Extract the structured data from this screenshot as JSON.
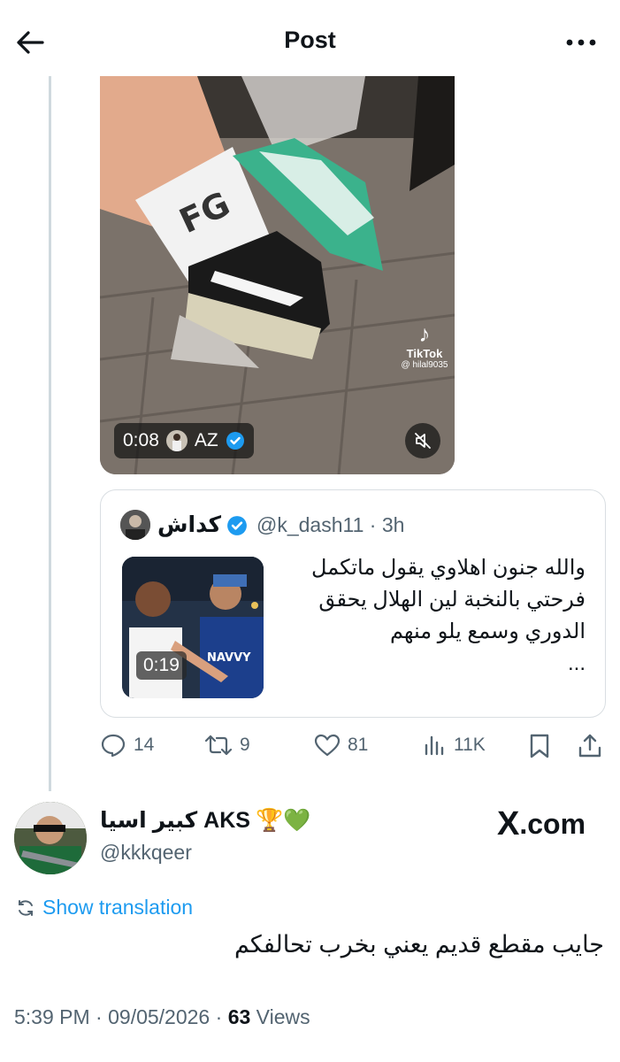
{
  "header": {
    "title": "Post"
  },
  "video": {
    "duration": "0:08",
    "author_name": "AZ",
    "watermark_brand": "TikTok",
    "watermark_handle": "@ hilal9035",
    "sock_text": "FG"
  },
  "quote": {
    "name": "كداش",
    "handle": "@k_dash11",
    "time": "3h",
    "text_line1": "والله جنون اهلاوي يقول ماتكمل",
    "text_line2": "فرحتي بالنخبة لين الهلال يحقق",
    "text_line3": "الدوري وسمع يلو منهم",
    "text_more": "...",
    "video_duration": "0:19",
    "thumb_shirt_text": "NAVVY"
  },
  "actions": {
    "replies": "14",
    "reposts": "9",
    "likes": "81",
    "views": "11K"
  },
  "reply": {
    "name": "كبير اسيا AKS",
    "emoji": "🏆💚",
    "handle": "@kkkqeer",
    "show_translation": "Show translation",
    "text": "جايب مقطع قديم يعني بخرب تحالفكم",
    "time": "5:39 PM",
    "date": "09/05/2026",
    "views_count": "63",
    "views_label": "Views"
  },
  "watermark": {
    "text": ".com",
    "logo": "X"
  },
  "colors": {
    "accent": "#1d9bf0",
    "secondary_text": "#536471",
    "thread_line": "#cfd9de"
  }
}
